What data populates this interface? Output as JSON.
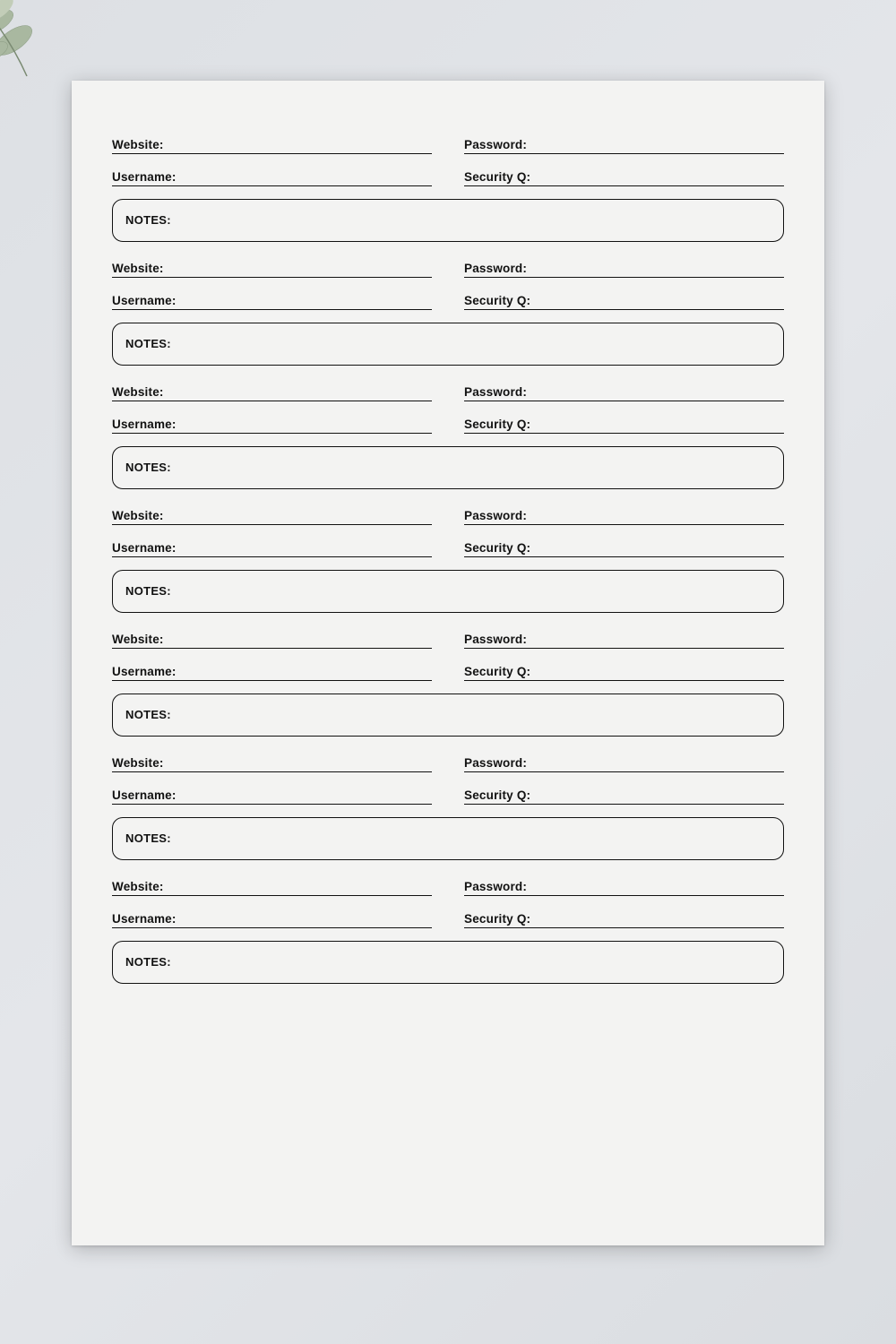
{
  "labels": {
    "website": "Website:",
    "password": "Password:",
    "username": "Username:",
    "securityQ": "Security Q:",
    "notes": "NOTES:"
  },
  "entries": [
    {
      "website": "",
      "password": "",
      "username": "",
      "securityQ": "",
      "notes": ""
    },
    {
      "website": "",
      "password": "",
      "username": "",
      "securityQ": "",
      "notes": ""
    },
    {
      "website": "",
      "password": "",
      "username": "",
      "securityQ": "",
      "notes": ""
    },
    {
      "website": "",
      "password": "",
      "username": "",
      "securityQ": "",
      "notes": ""
    },
    {
      "website": "",
      "password": "",
      "username": "",
      "securityQ": "",
      "notes": ""
    },
    {
      "website": "",
      "password": "",
      "username": "",
      "securityQ": "",
      "notes": ""
    },
    {
      "website": "",
      "password": "",
      "username": "",
      "securityQ": "",
      "notes": ""
    }
  ]
}
